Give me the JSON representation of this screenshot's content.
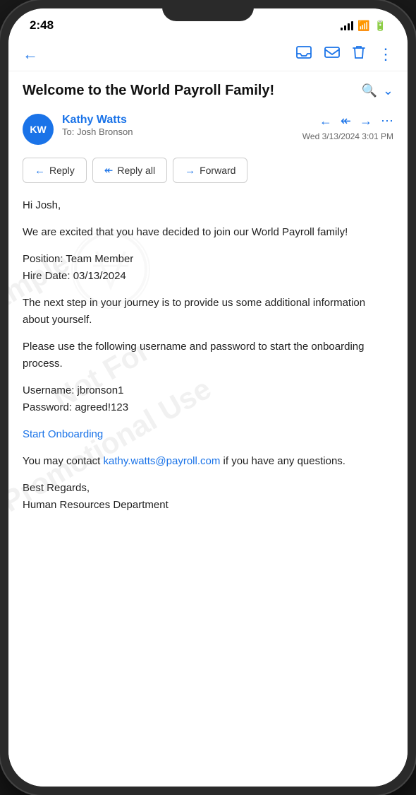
{
  "statusBar": {
    "time": "2:48",
    "signal": "signal-icon",
    "wifi": "wifi-icon",
    "battery": "battery-icon"
  },
  "topNav": {
    "backLabel": "←",
    "icons": [
      "inbox-icon",
      "mail-icon",
      "trash-icon",
      "more-icon"
    ]
  },
  "email": {
    "subject": "Welcome to the World Payroll Family!",
    "sender": {
      "initials": "KW",
      "name": "Kathy Watts",
      "to": "To: Josh Bronson",
      "date": "Wed 3/13/2024 3:01 PM"
    },
    "actions": {
      "reply": "Reply",
      "replyAll": "Reply all",
      "forward": "Forward"
    },
    "body": {
      "greeting": "Hi Josh,",
      "paragraph1": "We are excited that you have decided to join our World Payroll family!",
      "position": "Position: Team Member",
      "hireDate": "Hire Date: 03/13/2024",
      "paragraph2": "The next step in your journey is to provide us some additional information about yourself.",
      "paragraph3": "Please use the following username and password to start the onboarding process.",
      "username": "Username: jbronson1",
      "password": "Password: agreed!123",
      "onboardingLink": "Start Onboarding",
      "contactPre": "You may contact ",
      "contactEmail": "kathy.watts@payroll.com",
      "contactPost": " if you have any questions.",
      "closing": "Best Regards,",
      "department": "Human Resources Department"
    },
    "watermarks": [
      "Sample",
      "Not For",
      "Promotional Use"
    ]
  }
}
